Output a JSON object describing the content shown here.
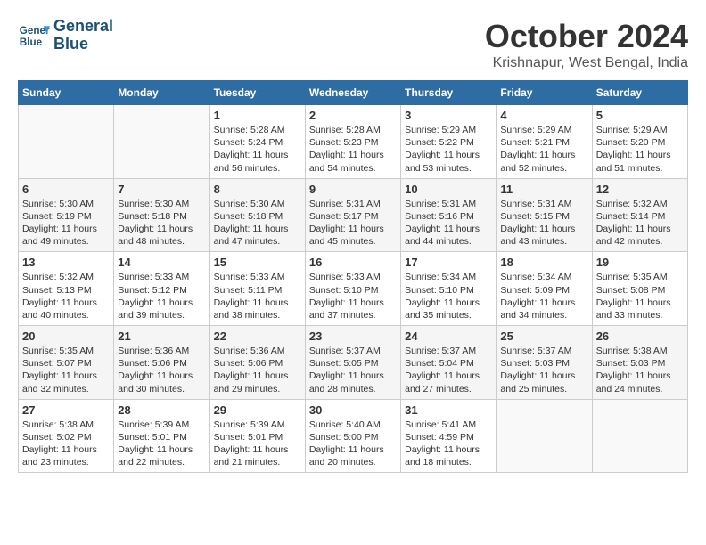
{
  "header": {
    "logo_line1": "General",
    "logo_line2": "Blue",
    "month": "October 2024",
    "location": "Krishnapur, West Bengal, India"
  },
  "days_of_week": [
    "Sunday",
    "Monday",
    "Tuesday",
    "Wednesday",
    "Thursday",
    "Friday",
    "Saturday"
  ],
  "weeks": [
    [
      {
        "day": "",
        "info": ""
      },
      {
        "day": "",
        "info": ""
      },
      {
        "day": "1",
        "info": "Sunrise: 5:28 AM\nSunset: 5:24 PM\nDaylight: 11 hours and 56 minutes."
      },
      {
        "day": "2",
        "info": "Sunrise: 5:28 AM\nSunset: 5:23 PM\nDaylight: 11 hours and 54 minutes."
      },
      {
        "day": "3",
        "info": "Sunrise: 5:29 AM\nSunset: 5:22 PM\nDaylight: 11 hours and 53 minutes."
      },
      {
        "day": "4",
        "info": "Sunrise: 5:29 AM\nSunset: 5:21 PM\nDaylight: 11 hours and 52 minutes."
      },
      {
        "day": "5",
        "info": "Sunrise: 5:29 AM\nSunset: 5:20 PM\nDaylight: 11 hours and 51 minutes."
      }
    ],
    [
      {
        "day": "6",
        "info": "Sunrise: 5:30 AM\nSunset: 5:19 PM\nDaylight: 11 hours and 49 minutes."
      },
      {
        "day": "7",
        "info": "Sunrise: 5:30 AM\nSunset: 5:18 PM\nDaylight: 11 hours and 48 minutes."
      },
      {
        "day": "8",
        "info": "Sunrise: 5:30 AM\nSunset: 5:18 PM\nDaylight: 11 hours and 47 minutes."
      },
      {
        "day": "9",
        "info": "Sunrise: 5:31 AM\nSunset: 5:17 PM\nDaylight: 11 hours and 45 minutes."
      },
      {
        "day": "10",
        "info": "Sunrise: 5:31 AM\nSunset: 5:16 PM\nDaylight: 11 hours and 44 minutes."
      },
      {
        "day": "11",
        "info": "Sunrise: 5:31 AM\nSunset: 5:15 PM\nDaylight: 11 hours and 43 minutes."
      },
      {
        "day": "12",
        "info": "Sunrise: 5:32 AM\nSunset: 5:14 PM\nDaylight: 11 hours and 42 minutes."
      }
    ],
    [
      {
        "day": "13",
        "info": "Sunrise: 5:32 AM\nSunset: 5:13 PM\nDaylight: 11 hours and 40 minutes."
      },
      {
        "day": "14",
        "info": "Sunrise: 5:33 AM\nSunset: 5:12 PM\nDaylight: 11 hours and 39 minutes."
      },
      {
        "day": "15",
        "info": "Sunrise: 5:33 AM\nSunset: 5:11 PM\nDaylight: 11 hours and 38 minutes."
      },
      {
        "day": "16",
        "info": "Sunrise: 5:33 AM\nSunset: 5:10 PM\nDaylight: 11 hours and 37 minutes."
      },
      {
        "day": "17",
        "info": "Sunrise: 5:34 AM\nSunset: 5:10 PM\nDaylight: 11 hours and 35 minutes."
      },
      {
        "day": "18",
        "info": "Sunrise: 5:34 AM\nSunset: 5:09 PM\nDaylight: 11 hours and 34 minutes."
      },
      {
        "day": "19",
        "info": "Sunrise: 5:35 AM\nSunset: 5:08 PM\nDaylight: 11 hours and 33 minutes."
      }
    ],
    [
      {
        "day": "20",
        "info": "Sunrise: 5:35 AM\nSunset: 5:07 PM\nDaylight: 11 hours and 32 minutes."
      },
      {
        "day": "21",
        "info": "Sunrise: 5:36 AM\nSunset: 5:06 PM\nDaylight: 11 hours and 30 minutes."
      },
      {
        "day": "22",
        "info": "Sunrise: 5:36 AM\nSunset: 5:06 PM\nDaylight: 11 hours and 29 minutes."
      },
      {
        "day": "23",
        "info": "Sunrise: 5:37 AM\nSunset: 5:05 PM\nDaylight: 11 hours and 28 minutes."
      },
      {
        "day": "24",
        "info": "Sunrise: 5:37 AM\nSunset: 5:04 PM\nDaylight: 11 hours and 27 minutes."
      },
      {
        "day": "25",
        "info": "Sunrise: 5:37 AM\nSunset: 5:03 PM\nDaylight: 11 hours and 25 minutes."
      },
      {
        "day": "26",
        "info": "Sunrise: 5:38 AM\nSunset: 5:03 PM\nDaylight: 11 hours and 24 minutes."
      }
    ],
    [
      {
        "day": "27",
        "info": "Sunrise: 5:38 AM\nSunset: 5:02 PM\nDaylight: 11 hours and 23 minutes."
      },
      {
        "day": "28",
        "info": "Sunrise: 5:39 AM\nSunset: 5:01 PM\nDaylight: 11 hours and 22 minutes."
      },
      {
        "day": "29",
        "info": "Sunrise: 5:39 AM\nSunset: 5:01 PM\nDaylight: 11 hours and 21 minutes."
      },
      {
        "day": "30",
        "info": "Sunrise: 5:40 AM\nSunset: 5:00 PM\nDaylight: 11 hours and 20 minutes."
      },
      {
        "day": "31",
        "info": "Sunrise: 5:41 AM\nSunset: 4:59 PM\nDaylight: 11 hours and 18 minutes."
      },
      {
        "day": "",
        "info": ""
      },
      {
        "day": "",
        "info": ""
      }
    ]
  ]
}
